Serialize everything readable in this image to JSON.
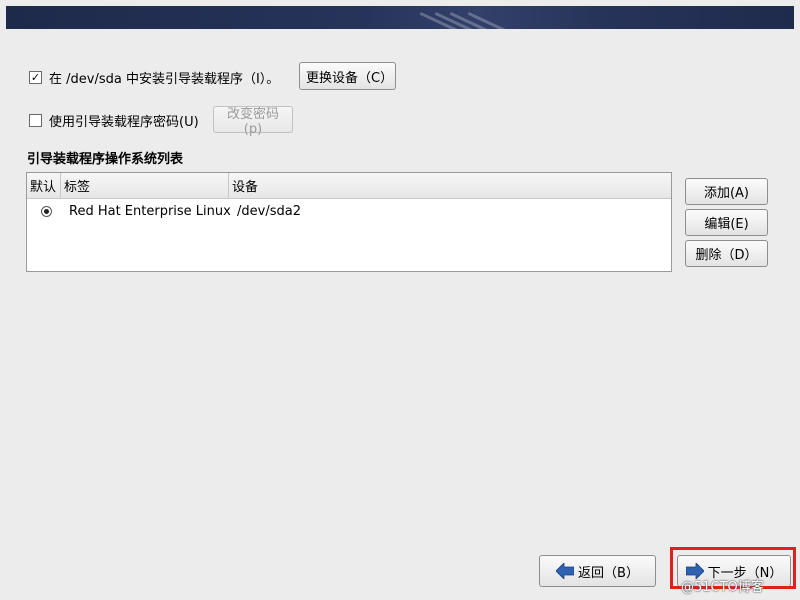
{
  "bootloader": {
    "install_checkbox": {
      "checked": true,
      "label": "在 /dev/sda 中安装引导装载程序（I）。"
    },
    "change_device_label": "更换设备（C）",
    "password_checkbox": {
      "checked": false,
      "label": "使用引导装载程序密码(U)"
    },
    "change_password_label": "改变密码(p)"
  },
  "os_list": {
    "title": "引导装载程序操作系统列表",
    "columns": [
      "默认",
      "标签",
      "设备"
    ],
    "rows": [
      {
        "default": true,
        "label": "Red Hat Enterprise Linux",
        "device": "/dev/sda2"
      }
    ]
  },
  "side_buttons": {
    "add": "添加(A)",
    "edit": "编辑(E)",
    "delete": "删除（D）"
  },
  "nav": {
    "back": "返回（B）",
    "next": "下一步（N）"
  },
  "watermark": "@51CTO博客",
  "colors": {
    "highlight": "#e0201c",
    "arrow": "#2f62b3"
  }
}
